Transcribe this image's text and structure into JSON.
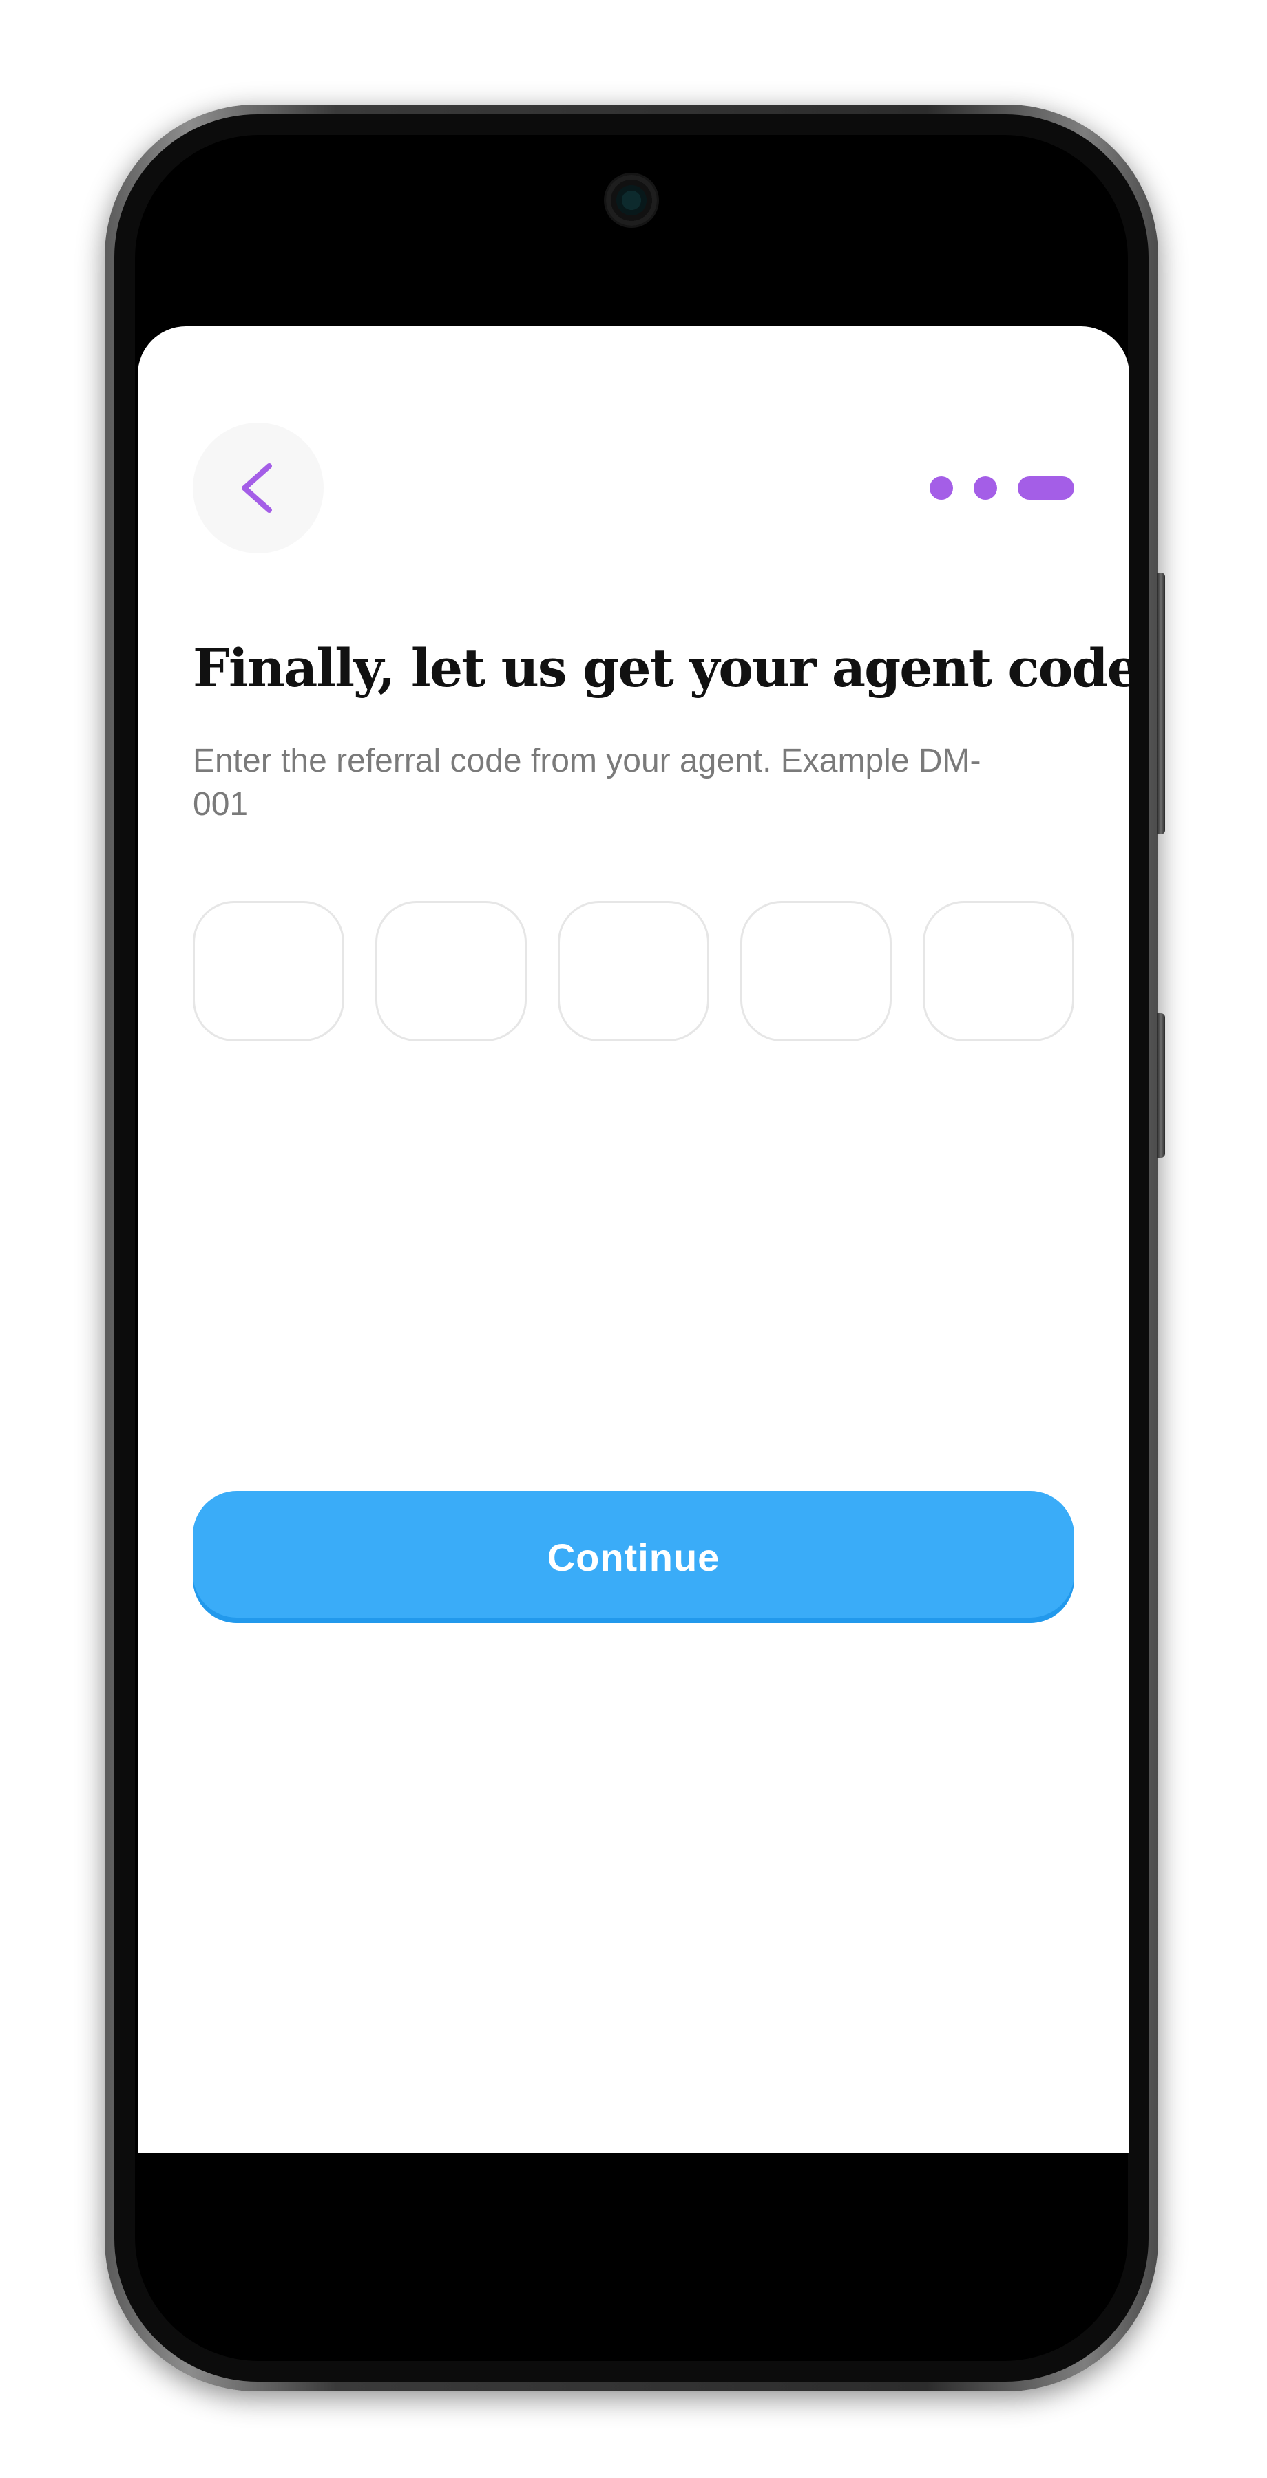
{
  "header": {
    "back_icon": "chevron-left-icon",
    "progress_steps_total": 3,
    "progress_current_step": 3
  },
  "content": {
    "title": "Finally, let us get your agent code",
    "subtitle": "Enter the referral code from your agent. Example DM-001"
  },
  "code_inputs": [
    {
      "value": ""
    },
    {
      "value": ""
    },
    {
      "value": ""
    },
    {
      "value": ""
    },
    {
      "value": ""
    }
  ],
  "actions": {
    "continue_label": "Continue"
  },
  "colors": {
    "accent_purple": "#a45ee7",
    "primary_button": "#3aacf8",
    "title_text": "#111111",
    "subtitle_text": "#7a7a7a",
    "input_border": "#e6e6e6"
  }
}
